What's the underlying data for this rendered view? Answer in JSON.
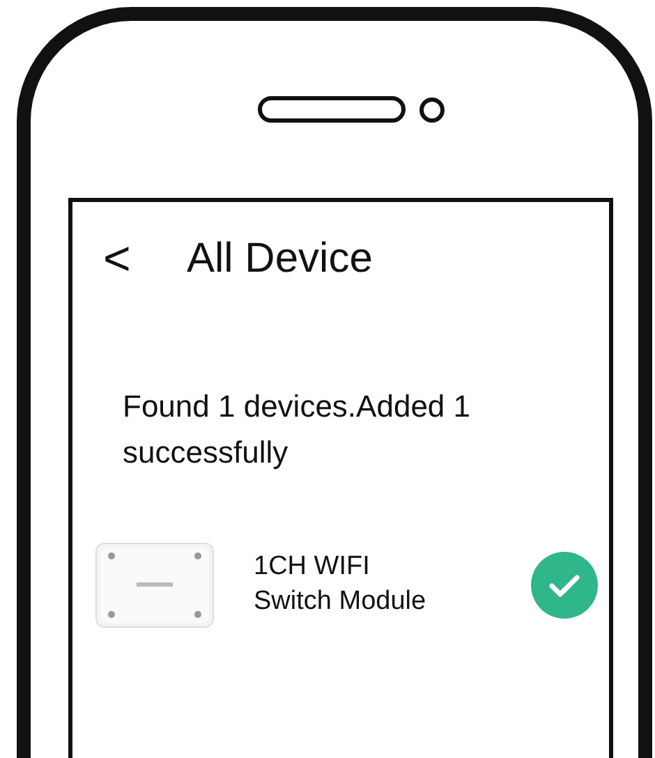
{
  "header": {
    "back": "<",
    "title": "All Device"
  },
  "message": "Found 1 devices.Added 1 successfully",
  "devices": [
    {
      "name": "1CH WIFI\nSwitch Module",
      "kind": "picture",
      "added": true
    }
  ]
}
